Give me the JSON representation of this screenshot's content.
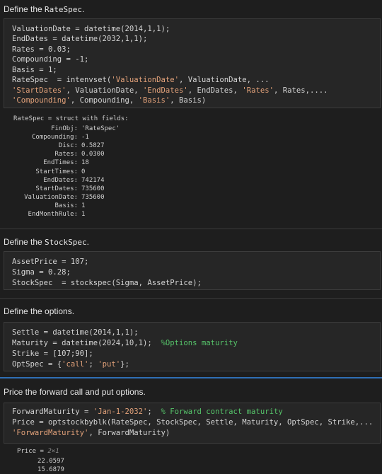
{
  "section1": {
    "heading_prefix": "Define the ",
    "heading_code": "RateSpec",
    "heading_suffix": ".",
    "code": {
      "l1": "ValuationDate = datetime(2014,1,1);",
      "l2": "EndDates = datetime(2032,1,1);",
      "l3": "Rates = 0.03;",
      "l4": "Compounding = -1;",
      "l5": "Basis = 1;",
      "l6a": "RateSpec  = intenvset(",
      "l6b": "'ValuationDate'",
      "l6c": ", ValuationDate, ...",
      "l7a": "'StartDates'",
      "l7b": ", ValuationDate, ",
      "l7c": "'EndDates'",
      "l7d": ", EndDates, ",
      "l7e": "'Rates'",
      "l7f": ", Rates,....",
      "l8a": "'Compounding'",
      "l8b": ", Compounding, ",
      "l8c": "'Basis'",
      "l8d": ", Basis)"
    },
    "output": {
      "header": "RateSpec = struct with fields:",
      "fields": [
        {
          "name": "FinObj:",
          "value": "'RateSpec'"
        },
        {
          "name": "Compounding:",
          "value": "-1"
        },
        {
          "name": "Disc:",
          "value": "0.5827"
        },
        {
          "name": "Rates:",
          "value": "0.0300"
        },
        {
          "name": "EndTimes:",
          "value": "18"
        },
        {
          "name": "StartTimes:",
          "value": "0"
        },
        {
          "name": "EndDates:",
          "value": "742174"
        },
        {
          "name": "StartDates:",
          "value": "735600"
        },
        {
          "name": "ValuationDate:",
          "value": "735600"
        },
        {
          "name": "Basis:",
          "value": "1"
        },
        {
          "name": "EndMonthRule:",
          "value": "1"
        }
      ]
    }
  },
  "section2": {
    "heading_prefix": "Define the ",
    "heading_code": "StockSpec",
    "heading_suffix": ".",
    "code": {
      "l1": "AssetPrice = 107;",
      "l2": "Sigma = 0.28;",
      "l3": "StockSpec  = stockspec(Sigma, AssetPrice);"
    }
  },
  "section3": {
    "heading": "Define the options.",
    "code": {
      "l1": "Settle = datetime(2014,1,1);",
      "l2a": "Maturity = datetime(2024,10,1);  ",
      "l2b": "%Options maturity",
      "l3": "Strike = [107;90];",
      "l4a": "OptSpec = {",
      "l4b": "'call'",
      "l4c": "; ",
      "l4d": "'put'",
      "l4e": "};"
    }
  },
  "section4": {
    "heading": "Price the forward call and put options.",
    "code": {
      "l1a": "ForwardMaturity = ",
      "l1b": "'Jan-1-2032'",
      "l1c": ";  ",
      "l1d": "% Forward contract maturity",
      "l2": "Price = optstockbyblk(RateSpec, StockSpec, Settle, Maturity, OptSpec, Strike,...",
      "l3a": "'ForwardMaturity'",
      "l3b": ", ForwardMaturity)"
    },
    "output": {
      "label": "Price",
      "eq": " = ",
      "dims": "2×1",
      "values": [
        "22.0597",
        "15.6879"
      ]
    }
  }
}
